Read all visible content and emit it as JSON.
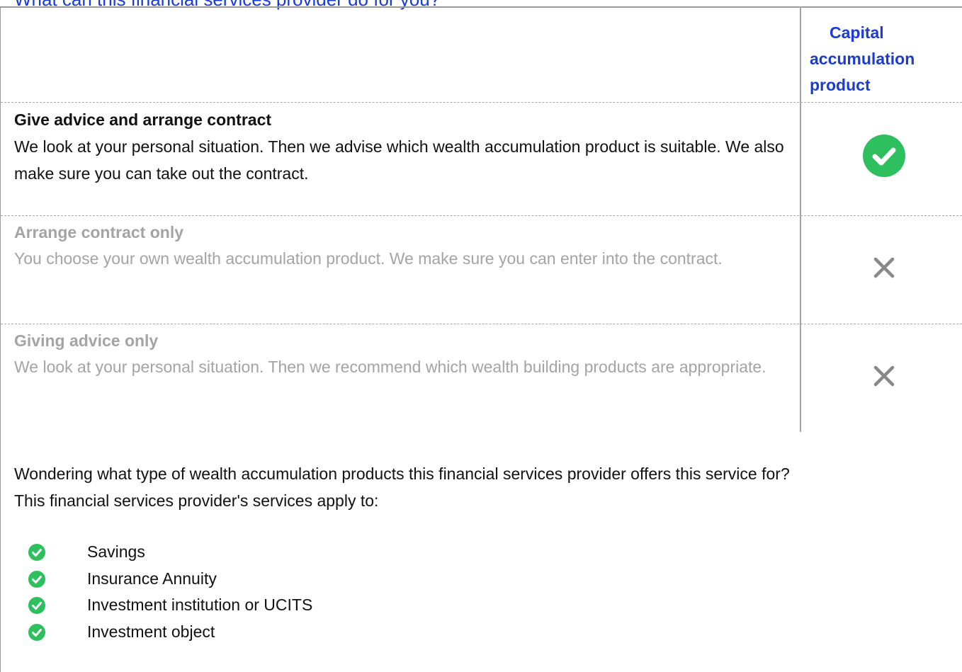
{
  "page": {
    "heading": "What can this financial services provider do for you?"
  },
  "table": {
    "column_header": "Capital accumulation product",
    "rows": [
      {
        "title": "Give advice and arrange contract",
        "description": "We look at your personal situation. Then we advise which wealth accumulation product is suitable. We also make sure you can take out the contract.",
        "status": "check-icon"
      },
      {
        "title": "Arrange contract only",
        "description": "You choose your own wealth accumulation product. We make sure you can enter into the contract.",
        "status": "cross-icon"
      },
      {
        "title": "Giving advice only",
        "description": "We look at your personal situation. Then we recommend which wealth building products are appropriate.",
        "status": "cross-icon"
      }
    ]
  },
  "products": {
    "intro_line1": "Wondering what type of wealth accumulation products this financial services provider offers this service for?",
    "intro_line2": "This financial services provider's services apply to:",
    "items": [
      "Savings",
      "Insurance Annuity",
      "Investment institution or UCITS",
      "Investment object"
    ]
  },
  "colors": {
    "accent_blue": "#1a3bd6",
    "check_green": "#2ec05e",
    "muted_gray": "#a4a4a4",
    "cross_gray": "#888888"
  }
}
